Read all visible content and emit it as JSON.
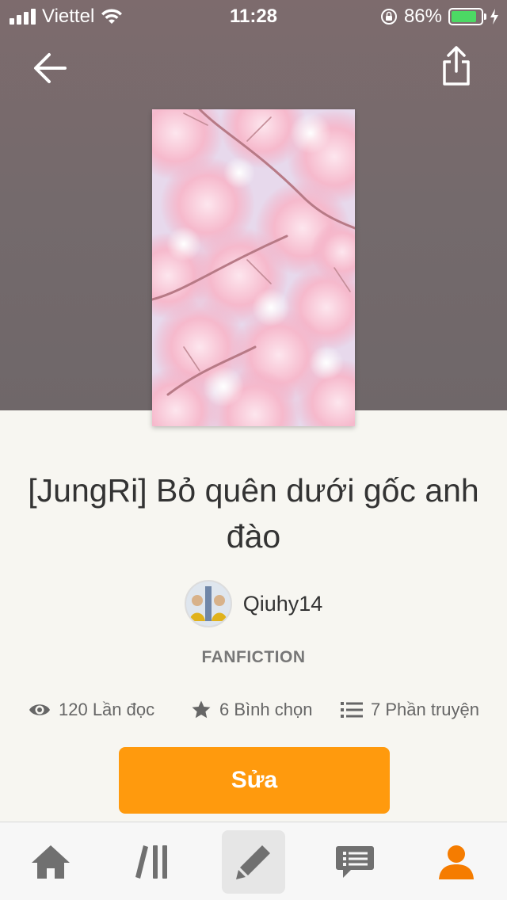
{
  "status_bar": {
    "carrier": "Viettel",
    "time": "11:28",
    "battery_percent": "86%",
    "battery_level": 0.86,
    "battery_color": "#4cd964"
  },
  "header": {
    "back_icon": "arrow-left-icon",
    "share_icon": "share-icon",
    "background_color": "#776b6d"
  },
  "story": {
    "cover_image": "cherry-blossom-cover",
    "title": "[JungRi] Bỏ quên dưới gốc anh đào",
    "author": "Qiuhy14",
    "category": "FANFICTION",
    "stats": {
      "reads": "120 Lần đọc",
      "votes": "6 Bình chọn",
      "parts": "7 Phần truyện"
    }
  },
  "actions": {
    "edit_label": "Sửa",
    "accent_color": "#ff9a0d"
  },
  "tab_bar": {
    "items": [
      {
        "icon": "home-icon",
        "active": false
      },
      {
        "icon": "library-icon",
        "active": false
      },
      {
        "icon": "pencil-icon",
        "active": true
      },
      {
        "icon": "messages-icon",
        "active": false
      },
      {
        "icon": "profile-icon",
        "active": false,
        "color": "#f57c00"
      }
    ]
  }
}
